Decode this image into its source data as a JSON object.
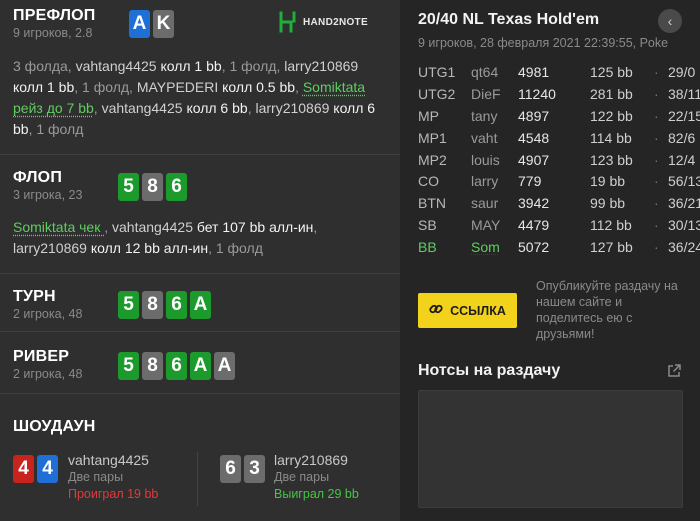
{
  "preflop": {
    "title": "ПРЕФЛОП",
    "sub": "9 игроков, 2.8",
    "hero_cards": [
      {
        "rank": "A",
        "color": "#1e6fd6"
      },
      {
        "rank": "K",
        "color": "#6c6c6c"
      }
    ],
    "logo_text": "HAND2NOTE",
    "actions": [
      {
        "t": "3 фолда, ",
        "c": "muted"
      },
      {
        "t": "vahtang4425 ",
        "c": "pl"
      },
      {
        "t": "колл 1 bb",
        "c": "strong"
      },
      {
        "t": ", 1 фолд, ",
        "c": "muted"
      },
      {
        "t": "larry210869 ",
        "c": "pl"
      },
      {
        "t": "колл 1 bb",
        "c": "strong"
      },
      {
        "t": ", 1 фолд, ",
        "c": "muted"
      },
      {
        "t": "MAYPEDERI ",
        "c": "pl"
      },
      {
        "t": "колл 0.5 bb",
        "c": "strong"
      },
      {
        "t": ", ",
        "c": "muted"
      },
      {
        "t": "Somiktata рейз до 7 bb",
        "c": "hero"
      },
      {
        "t": ", ",
        "c": "muted"
      },
      {
        "t": "vahtang4425 ",
        "c": "pl"
      },
      {
        "t": "колл 6 bb",
        "c": "strong"
      },
      {
        "t": ", ",
        "c": "muted"
      },
      {
        "t": "larry210869 ",
        "c": "pl"
      },
      {
        "t": "колл 6 bb",
        "c": "strong"
      },
      {
        "t": ", 1 фолд",
        "c": "muted"
      }
    ]
  },
  "flop": {
    "title": "ФЛОП",
    "sub": "3 игрока, 23",
    "cards": [
      {
        "rank": "5",
        "color": "#1c9b2c"
      },
      {
        "rank": "8",
        "color": "#6c6c6c"
      },
      {
        "rank": "6",
        "color": "#1c9b2c"
      }
    ],
    "actions": [
      {
        "t": "Somiktata чек ",
        "c": "hero"
      },
      {
        "t": ", ",
        "c": "muted"
      },
      {
        "t": "vahtang4425 ",
        "c": "pl"
      },
      {
        "t": "бет 107 bb алл-ин",
        "c": "strong"
      },
      {
        "t": ", ",
        "c": "muted"
      },
      {
        "t": "larry210869 ",
        "c": "pl"
      },
      {
        "t": "колл 12 bb алл-ин",
        "c": "strong"
      },
      {
        "t": ", 1 фолд",
        "c": "muted"
      }
    ]
  },
  "turn": {
    "title": "ТУРН",
    "sub": "2 игрока, 48",
    "cards": [
      {
        "rank": "5",
        "color": "#1c9b2c"
      },
      {
        "rank": "8",
        "color": "#6c6c6c"
      },
      {
        "rank": "6",
        "color": "#1c9b2c"
      },
      {
        "rank": "A",
        "color": "#1c9b2c"
      }
    ]
  },
  "river": {
    "title": "РИВЕР",
    "sub": "2 игрока, 48",
    "cards": [
      {
        "rank": "5",
        "color": "#1c9b2c"
      },
      {
        "rank": "8",
        "color": "#6c6c6c"
      },
      {
        "rank": "6",
        "color": "#1c9b2c"
      },
      {
        "rank": "A",
        "color": "#1c9b2c"
      },
      {
        "rank": "A",
        "color": "#6c6c6c"
      }
    ]
  },
  "showdown": {
    "title": "ШОУДАУН",
    "players": [
      {
        "cards": [
          {
            "rank": "4",
            "color": "#c8231f"
          },
          {
            "rank": "4",
            "color": "#1e6fd6"
          }
        ],
        "name": "vahtang4425",
        "hand": "Две пары",
        "result": "Проиграл 19 bb",
        "won": false
      },
      {
        "cards": [
          {
            "rank": "6",
            "color": "#6c6c6c"
          },
          {
            "rank": "3",
            "color": "#6c6c6c"
          }
        ],
        "name": "larry210869",
        "hand": "Две пары",
        "result": "Выиграл 29 bb",
        "won": true
      }
    ]
  },
  "game": {
    "title": "20/40 NL Texas Hold'em",
    "sub": "9 игроков, 28 февраля 2021 22:39:55, Poke",
    "back_icon": "chevron-left-icon"
  },
  "players": [
    {
      "pos": "UTG1",
      "nick": "qt64",
      "stack": "4981",
      "bb": "125 bb",
      "dot": "·",
      "stat": "29/0",
      "hero": false
    },
    {
      "pos": "UTG2",
      "nick": "DieF",
      "stack": "11240",
      "bb": "281 bb",
      "dot": "·",
      "stat": "38/11",
      "hero": false
    },
    {
      "pos": "MP",
      "nick": "tany",
      "stack": "4897",
      "bb": "122 bb",
      "dot": "·",
      "stat": "22/15",
      "hero": false
    },
    {
      "pos": "MP1",
      "nick": "vaht",
      "stack": "4548",
      "bb": "114 bb",
      "dot": "·",
      "stat": "82/6",
      "hero": false
    },
    {
      "pos": "MP2",
      "nick": "louis",
      "stack": "4907",
      "bb": "123 bb",
      "dot": "·",
      "stat": "12/4",
      "hero": false
    },
    {
      "pos": "CO",
      "nick": "larry",
      "stack": "779",
      "bb": "19 bb",
      "dot": "·",
      "stat": "56/13",
      "hero": false
    },
    {
      "pos": "BTN",
      "nick": "saur",
      "stack": "3942",
      "bb": "99 bb",
      "dot": "·",
      "stat": "36/21",
      "hero": false
    },
    {
      "pos": "SB",
      "nick": "MAY",
      "stack": "4479",
      "bb": "112 bb",
      "dot": "·",
      "stat": "30/13",
      "hero": false
    },
    {
      "pos": "BB",
      "nick": "Som",
      "stack": "5072",
      "bb": "127 bb",
      "dot": "·",
      "stat": "36/24",
      "hero": true
    }
  ],
  "share": {
    "button_label": "ССЫЛКА",
    "button_icon": "link-icon",
    "text": "Опубликуйте раздачу на нашем сайте и поделитесь ею с друзьями!"
  },
  "notes": {
    "title": "Нотсы на раздачу",
    "external_icon": "external-link-icon"
  },
  "colors": {
    "accent_yellow": "#f2d21a",
    "hero_green": "#5fce5f",
    "card_green": "#1c9b2c",
    "card_gray": "#6c6c6c",
    "card_blue": "#1e6fd6",
    "card_red": "#c8231f",
    "lost_red": "#e23a3a",
    "won_green": "#45c545"
  }
}
